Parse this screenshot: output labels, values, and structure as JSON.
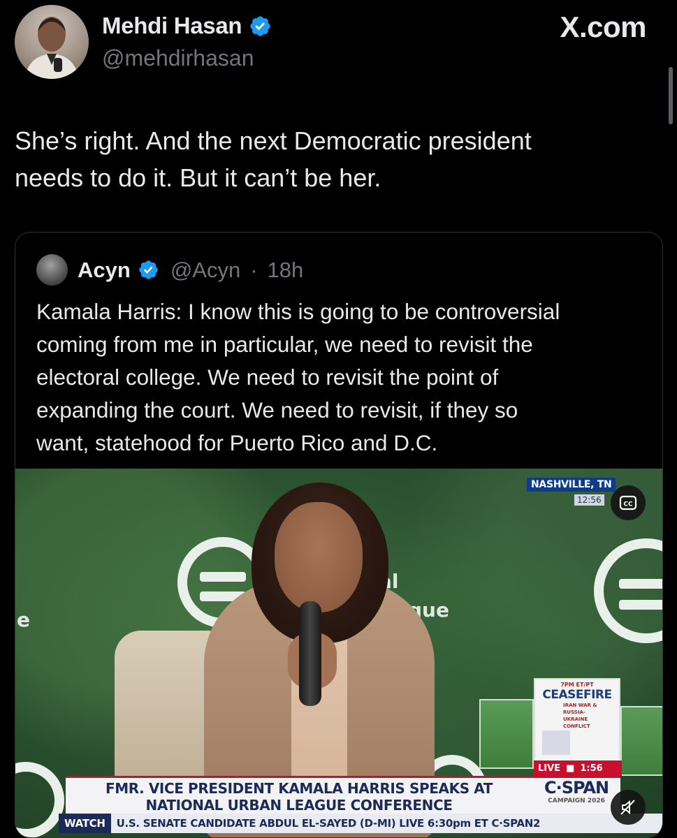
{
  "author": {
    "name": "Mehdi Hasan",
    "handle": "@mehdirhasan",
    "verified": true
  },
  "brand": "X.com",
  "tweet": {
    "lines": [
      "She’s right. And the next Democratic president",
      "needs to do it. But it can’t be her."
    ]
  },
  "quote": {
    "name": "Acyn",
    "handle": "@Acyn",
    "separator": "·",
    "time": "18h",
    "verified": true,
    "lines": [
      "Kamala Harris: I know this is going to be controversial",
      "coming from me in particular, we need to revisit the",
      "electoral college. We need to revisit the point of",
      "expanding the court. We need to revisit, if they so",
      "want, statehood for Puerto Rico and D.C."
    ]
  },
  "video": {
    "location": "NASHVILLE, TN",
    "location_time": "12:56",
    "bg_text_1": "al",
    "bg_text_2": "gue",
    "bg_text_3": "e",
    "promo_time": "7PM ET/PT",
    "promo_title": "CEASEFIRE",
    "promo_sub": [
      "IRAN WAR &",
      "RUSSIA-",
      "UKRAINE",
      "CONFLICT"
    ],
    "live_label": "LIVE",
    "live_time": "1:56",
    "headline": [
      "FMR. VICE PRESIDENT KAMALA HARRIS SPEAKS AT",
      "NATIONAL URBAN LEAGUE CONFERENCE"
    ],
    "network": "C·SPAN",
    "network_sub": "CAMPAIGN 2026",
    "ticker_label": "WATCH",
    "ticker_text": "U.S. SENATE CANDIDATE ABDUL EL-SAYED (D-MI)  LIVE 6:30pm ET C·SPAN2"
  },
  "colors": {
    "background": "#000000",
    "text": "#e7e9ea",
    "muted": "#71767b",
    "verified": "#1d9bf0",
    "card_border": "#2f3336"
  },
  "icons": [
    "verified-badge-icon",
    "closed-captions-icon",
    "mute-icon"
  ]
}
